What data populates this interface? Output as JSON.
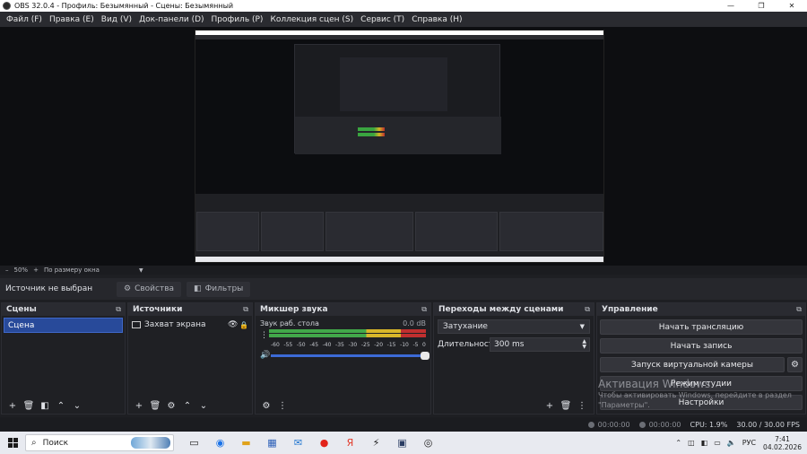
{
  "window": {
    "title": "OBS 32.0.4 - Профиль: Безымянный - Сцены: Безымянный",
    "minimize": "—",
    "maximize": "❐",
    "close": "✕"
  },
  "menu": [
    "Файл (F)",
    "Правка (E)",
    "Вид (V)",
    "Док-панели (D)",
    "Профиль (P)",
    "Коллекция сцен (S)",
    "Сервис (T)",
    "Справка (H)"
  ],
  "zoom": {
    "minus": "–",
    "level": "50%",
    "plus": "+",
    "fit": "По размеру окна",
    "caret": "▼"
  },
  "source_toolbar": {
    "no_source": "Источник не выбран",
    "properties": "Свойства",
    "filters": "Фильтры"
  },
  "scenes": {
    "title": "Сцены",
    "items": [
      "Сцена"
    ]
  },
  "sources": {
    "title": "Источники",
    "items": [
      "Захват экрана"
    ]
  },
  "mixer": {
    "title": "Микшер звука",
    "channel": "Звук раб. стола",
    "db": "0.0 dB",
    "ticks": [
      "-60",
      "-55",
      "-50",
      "-45",
      "-40",
      "-35",
      "-30",
      "-25",
      "-20",
      "-15",
      "-10",
      "-5",
      "0"
    ]
  },
  "transitions": {
    "title": "Переходы между сценами",
    "selected": "Затухание",
    "duration_label": "Длительность",
    "duration_value": "300 ms"
  },
  "controls": {
    "title": "Управление",
    "start_stream": "Начать трансляцию",
    "start_record": "Начать запись",
    "virtual_cam": "Запуск виртуальной камеры",
    "studio_mode": "Режим студии",
    "settings": "Настройки"
  },
  "watermark": {
    "line1": "Активация Windows",
    "line2": "Чтобы активировать Windows, перейдите в раздел",
    "line3": "\"Параметры\"."
  },
  "status": {
    "stream_time": "00:00:00",
    "record_time": "00:00:00",
    "cpu": "CPU: 1.9%",
    "fps": "30.00 / 30.00 FPS"
  },
  "taskbar": {
    "search": "Поиск",
    "lang": "РУС",
    "time": "7:41",
    "date": "04.02.2026"
  },
  "colors": {
    "accent": "#284a9a",
    "meter_green": "#42a84a",
    "meter_yellow": "#d8b62a",
    "meter_red": "#c02f2f",
    "volume": "#3c6ad6"
  },
  "icons": [
    "gear-icon",
    "eye-icon",
    "lock-icon",
    "speaker-icon",
    "popout-icon",
    "plus-icon",
    "trash-icon",
    "up-icon",
    "down-icon",
    "search-icon",
    "windows-icon"
  ]
}
